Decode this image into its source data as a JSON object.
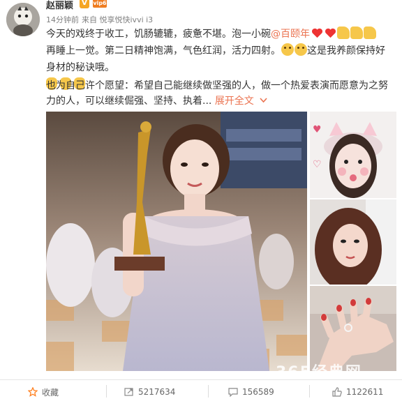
{
  "post": {
    "username": "赵丽颖",
    "verified_badge": "V",
    "vip_badge": "vip6",
    "time": "14分钟前",
    "source_prefix": "来自",
    "source": "悦享悦快ivvi i3",
    "line1_a": "今天的戏终于收工，饥肠辘辘，疲惫不堪。泡一小碗",
    "mention": "@百颐年",
    "line2_a": "再睡上一觉。第二日精神饱满，气色红润，活力四射。",
    "line2_b": "这是我养颜保持好",
    "line3": "身材的秘诀哦。",
    "line4": "也为自己许个愿望：希望自己能继续做坚强的人，做一个热爱表演而愿意为之努",
    "line5": "力的人，可以继续倔强、坚持、执着...",
    "expand_label": "展开全文",
    "expand_icon": "chevron-down-icon"
  },
  "images": {
    "main_alt": "award-trophy-photo",
    "side1_alt": "selfie-with-cat-ears",
    "side2_alt": "selfie-portrait",
    "side3_alt": "hand-with-ring"
  },
  "watermark": "365经典网",
  "actions": {
    "favorite_label": "收藏",
    "repost_count": "5217634",
    "comment_count": "156589",
    "like_count": "1122611"
  },
  "colors": {
    "accent": "#eb7350",
    "text": "#333333",
    "muted": "#808080"
  }
}
